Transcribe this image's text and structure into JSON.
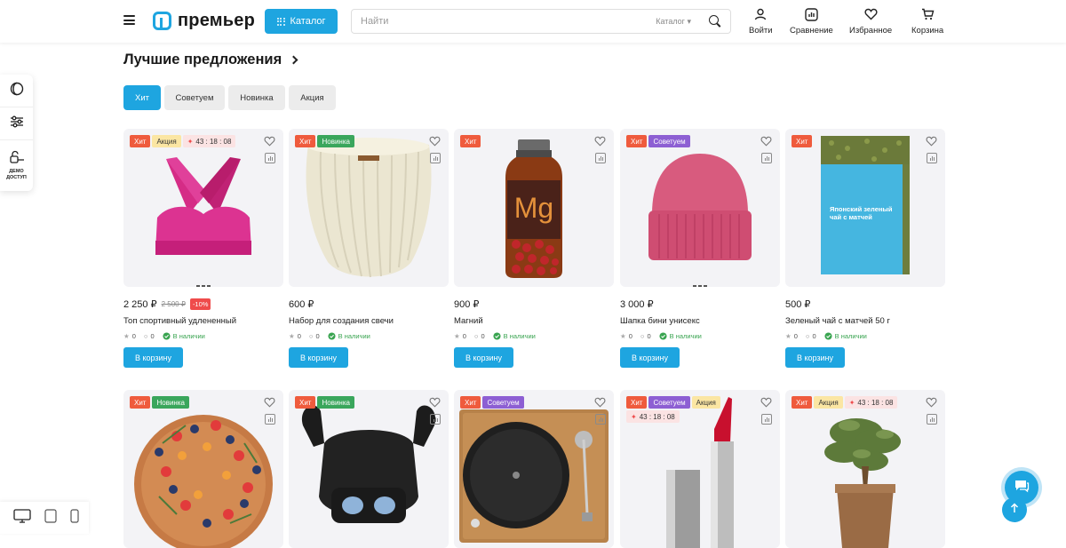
{
  "header": {
    "logo_text": "премьер",
    "catalog_label": "Каталог",
    "search_placeholder": "Найти",
    "search_scope": "Каталог",
    "actions": [
      {
        "label": "Войти",
        "icon": "user-icon"
      },
      {
        "label": "Сравнение",
        "icon": "compare-icon"
      },
      {
        "label": "Избранное",
        "icon": "heart-icon"
      },
      {
        "label": "Корзина",
        "icon": "cart-icon"
      }
    ]
  },
  "left_rail": {
    "demo_label_1": "ДЕМО",
    "demo_label_2": "ДОСТУП"
  },
  "section": {
    "title": "Лучшие предложения"
  },
  "tabs": [
    "Хит",
    "Советуем",
    "Новинка",
    "Акция"
  ],
  "badge_labels": {
    "hit": "Хит",
    "new": "Новинка",
    "rec": "Советуем",
    "sale": "Акция"
  },
  "timer": "43 : 18 : 08",
  "stock_label": "В наличии",
  "cart_label": "В корзину",
  "products": [
    {
      "price": "2 250 ₽",
      "old_price": "2 500 ₽",
      "discount": "-10%",
      "title": "Топ спортивный удлененный",
      "rating": "0",
      "reviews": "0"
    },
    {
      "price": "600 ₽",
      "title": "Набор для создания свечи",
      "rating": "0",
      "reviews": "0"
    },
    {
      "price": "900 ₽",
      "title": "Магний",
      "rating": "0",
      "reviews": "0",
      "label_text": "Mg"
    },
    {
      "price": "3 000 ₽",
      "title": "Шапка бини унисекс",
      "rating": "0",
      "reviews": "0"
    },
    {
      "price": "500 ₽",
      "title": "Зеленый чай с матчей 50 г",
      "rating": "0",
      "reviews": "0",
      "label_text": "Японский зеленый чай с матчей"
    }
  ],
  "colors": {
    "accent": "#1ea5e0",
    "hit": "#ef5b3d",
    "new": "#3aa65c",
    "recommend": "#8d5fd3",
    "sale": "#fbe6a3",
    "discount": "#ef4b4b",
    "in_stock": "#39a450"
  }
}
